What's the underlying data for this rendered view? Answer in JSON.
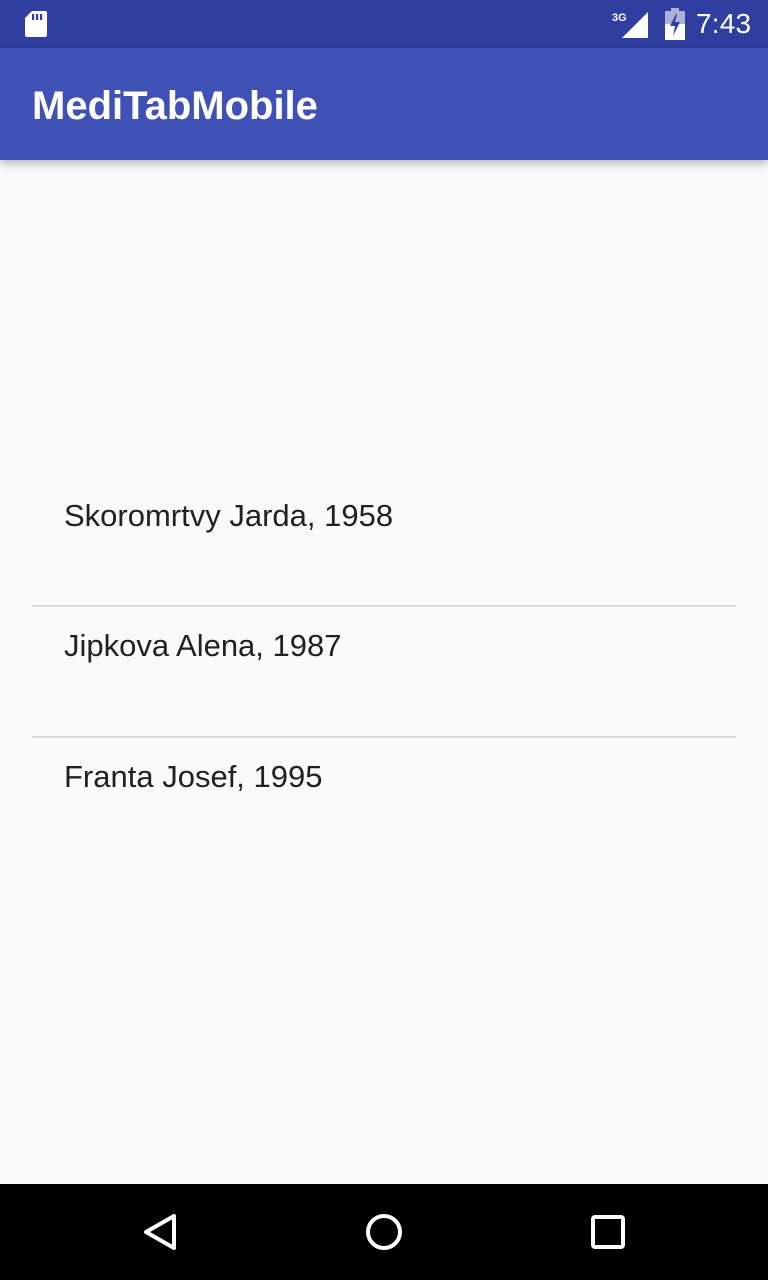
{
  "status_bar": {
    "network_type": "3G",
    "time": "7:43",
    "icons": [
      "sd-card-icon",
      "signal-3g-icon",
      "battery-charging-icon"
    ]
  },
  "app_bar": {
    "title": "MediTabMobile"
  },
  "patients": [
    {
      "label": "Skoromrtvy Jarda, 1958"
    },
    {
      "label": "Jipkova Alena, 1987"
    },
    {
      "label": "Franta Josef, 1995"
    }
  ],
  "nav_bar": {
    "icons": [
      "back-icon",
      "home-icon",
      "recents-icon"
    ]
  },
  "colors": {
    "status_bar": "#303f9f",
    "app_bar": "#3f51b5",
    "background": "#fafafa",
    "divider": "#d9d9d9",
    "text_primary": "#212121",
    "nav_bar": "#000000"
  }
}
